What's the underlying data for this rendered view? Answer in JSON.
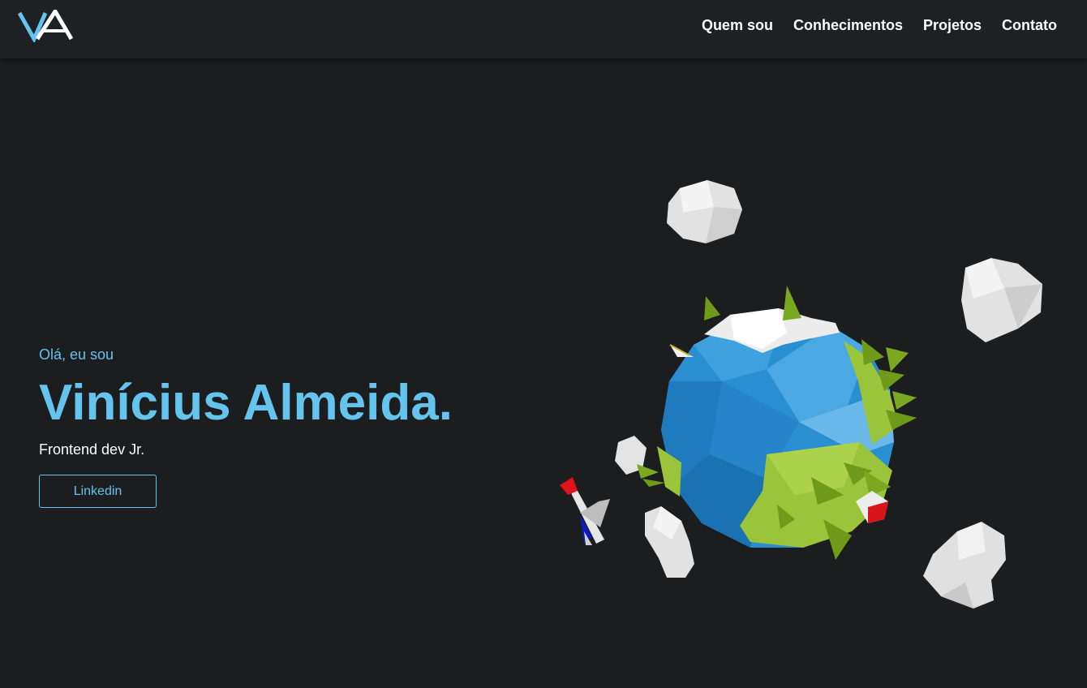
{
  "brand": {
    "logo_text": "VA",
    "accent_color": "#64c4ee"
  },
  "nav": {
    "items": [
      {
        "label": "Quem sou"
      },
      {
        "label": "Conhecimentos"
      },
      {
        "label": "Projetos"
      },
      {
        "label": "Contato"
      }
    ]
  },
  "hero": {
    "greeting": "Olá, eu sou",
    "name": "Vinícius Almeida.",
    "role": "Frontend dev Jr.",
    "linkedin_label": "Linkedin"
  },
  "illustration": {
    "icon": "low-poly-planet-icon",
    "colors": {
      "ocean": "#2a8fd0",
      "land": "#9ac43a",
      "cloud": "#e6e6e6",
      "background": "#1c1d1f"
    }
  }
}
